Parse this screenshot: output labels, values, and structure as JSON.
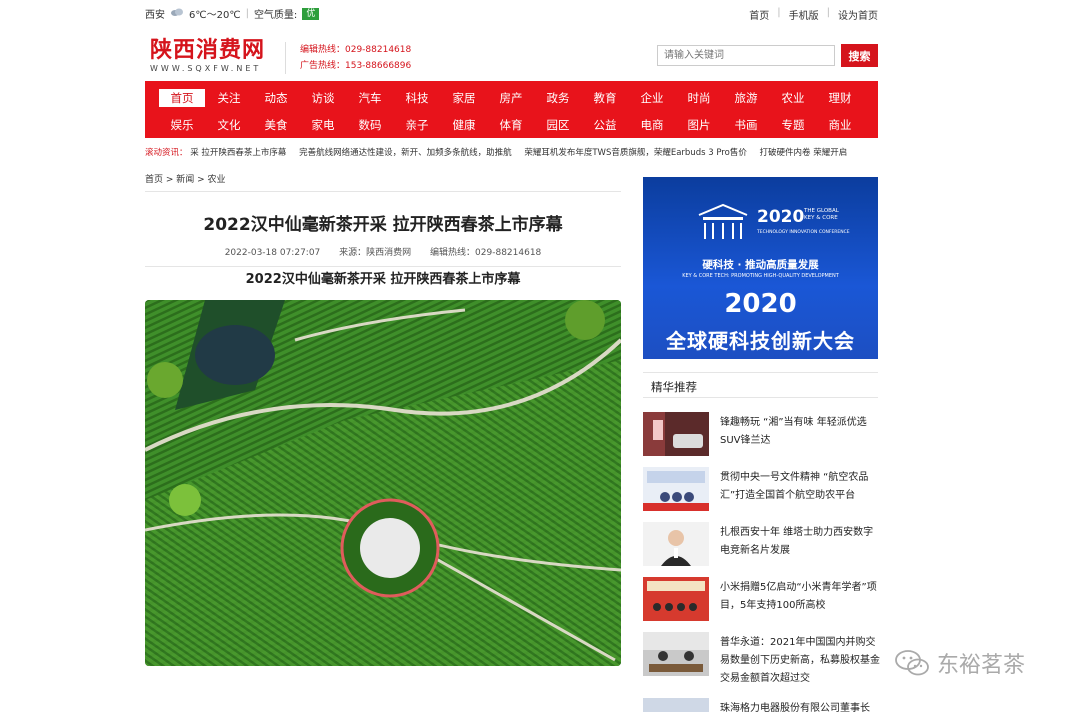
{
  "topbar": {
    "city": "西安",
    "temperature": "6℃～20℃",
    "air_label": "空气质量:",
    "air_value": "优",
    "links": [
      "首页",
      "手机版",
      "设为首页"
    ]
  },
  "header": {
    "logo_cn": "陕西消费网",
    "logo_en": "WWW.SQXFW.NET",
    "hotline_edit": "编辑热线：029-88214618",
    "hotline_ad": "广告热线：153-88666896",
    "search_placeholder": "请输入关键词",
    "search_button": "搜索"
  },
  "nav": {
    "row1": [
      "首页",
      "关注",
      "动态",
      "访谈",
      "汽车",
      "科技",
      "家居",
      "房产",
      "政务",
      "教育",
      "企业",
      "时尚",
      "旅游",
      "农业",
      "理财"
    ],
    "row2": [
      "娱乐",
      "文化",
      "美食",
      "家电",
      "数码",
      "亲子",
      "健康",
      "体育",
      "园区",
      "公益",
      "电商",
      "图片",
      "书画",
      "专题",
      "商业"
    ]
  },
  "ticker": {
    "label": "滚动资讯：",
    "items": [
      "采 拉开陕西春茶上市序幕",
      "完善航线网络通达性建设，新开、加频多条航线，助推航",
      "荣耀耳机发布年度TWS音质旗舰，荣耀Earbuds 3 Pro售价",
      "打破硬件内卷 荣耀开启"
    ]
  },
  "breadcrumb": "首页 > 新闻 > 农业",
  "article": {
    "title": "2022汉中仙毫新茶开采 拉开陕西春茶上市序幕",
    "date": "2022-03-18 07:27:07",
    "source": "来源：陕西消费网",
    "hotline": "编辑热线：029-88214618",
    "subtitle": "2022汉中仙毫新茶开采 拉开陕西春茶上市序幕"
  },
  "ad": {
    "year_top": "2020",
    "global_line1": "THE GLOBAL",
    "global_line2": "KEY & CORE",
    "conference": "TECHNOLOGY INNOVATION CONFERENCE",
    "slogan": "硬科技 · 推动高质量发展",
    "slogan_en": "KEY & CORE TECH: PROMOTING HIGH-QUALITY DEVELOPMENT",
    "year_big": "2020",
    "name": "全球硬科技创新大会"
  },
  "sidebar": {
    "section_title": "精华推荐",
    "items": [
      {
        "text": "锋趣畅玩 “湘”当有味 年轻派优选SUV锋兰达"
      },
      {
        "text": "贯彻中央一号文件精神 “航空农品汇”打造全国首个航空助农平台"
      },
      {
        "text": "扎根西安十年 维塔士助力西安数字电竞新名片发展"
      },
      {
        "text": "小米捐赠5亿启动“小米青年学者”项目，5年支持100所高校"
      },
      {
        "text": "普华永道：2021年中国国内并购交易数量创下历史新高，私募股权基金交易金额首次超过交"
      },
      {
        "text": "珠海格力电器股份有限公司董事长"
      }
    ]
  },
  "watermark": "东裕茗茶",
  "colors": {
    "brand_red": "#e8131b",
    "air_good": "#2e9e3c",
    "ad_blue": "#1a57d6"
  }
}
